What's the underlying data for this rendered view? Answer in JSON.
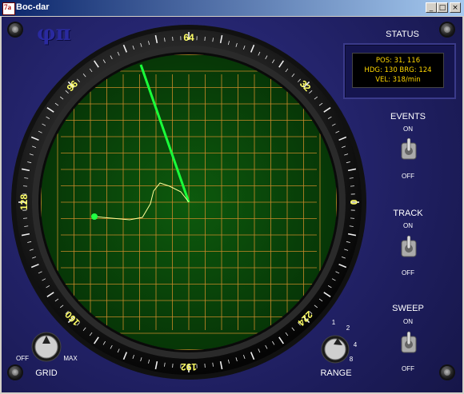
{
  "window": {
    "title": "Boc-dar",
    "minimize": "_",
    "maximize": "□",
    "close": "×"
  },
  "logo": "φπ",
  "compass": {
    "labels": [
      "64",
      "32",
      "0",
      "224",
      "192",
      "160",
      "128",
      "96"
    ]
  },
  "status": {
    "title": "STATUS",
    "line1": "POS: 31, 116",
    "line2": "HDG: 130  BRG: 124",
    "line3": "VEL: 318/min"
  },
  "toggles": [
    {
      "label": "EVENTS",
      "on": "ON",
      "off": "OFF"
    },
    {
      "label": "TRACK",
      "on": "ON",
      "off": "OFF"
    },
    {
      "label": "SWEEP",
      "on": "ON",
      "off": "OFF"
    }
  ],
  "grid_knob": {
    "label": "GRID",
    "off": "OFF",
    "max": "MAX"
  },
  "range_knob": {
    "label": "RANGE",
    "options": [
      "1",
      "2",
      "4",
      "8"
    ]
  },
  "colors": {
    "scope": "#0a4a0a",
    "grid": "#c98a2a",
    "sweep": "#1aff3a",
    "track": "#ffff99",
    "panel": "#1f1f66"
  }
}
